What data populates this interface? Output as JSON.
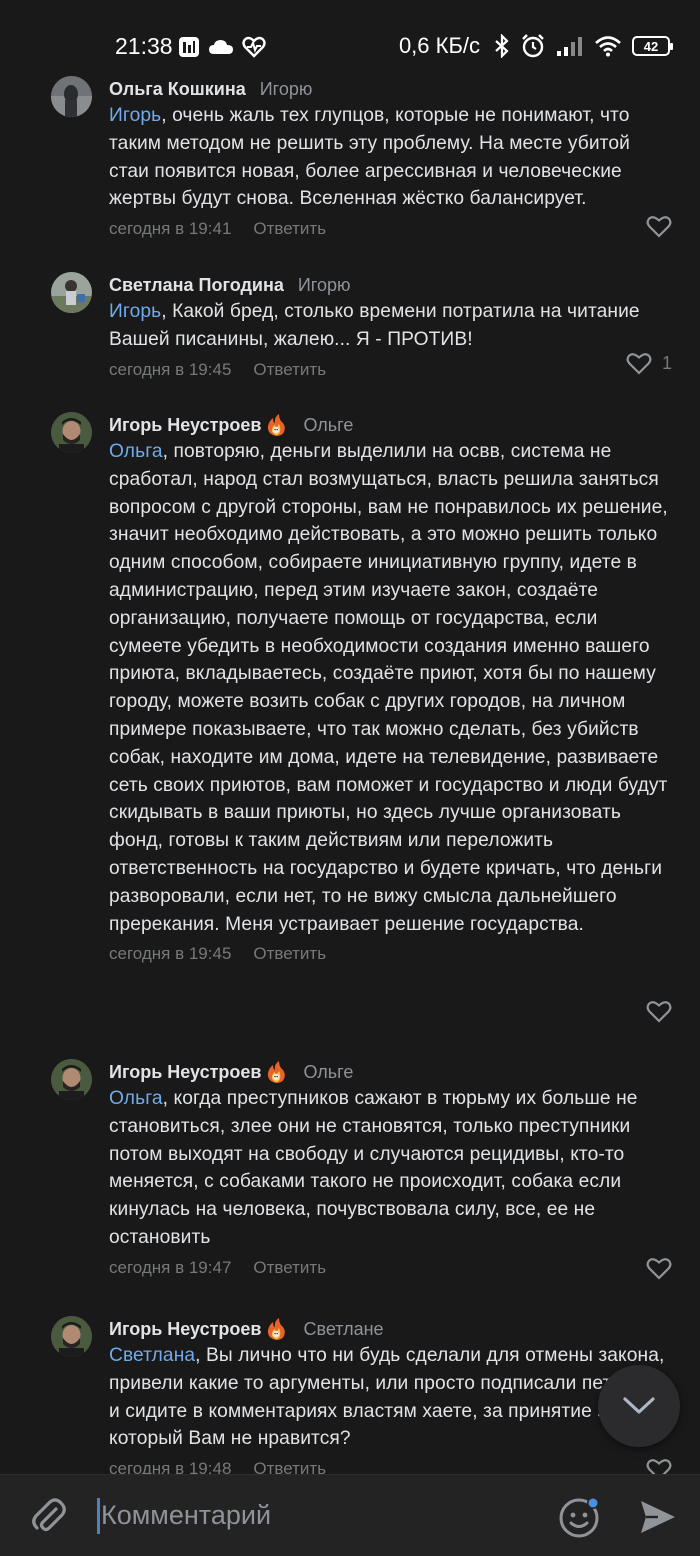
{
  "status_bar": {
    "time": "21:38",
    "speed": "0,6 КБ/с",
    "battery": "42"
  },
  "comments": [
    {
      "author": "Ольга Кошкина",
      "reply_to": "Игорю",
      "mention": "Игорь",
      "text": ", очень жаль тех глупцов, которые не понимают, что таким методом не решить эту проблему. На месте убитой стаи появится новая, более агрессивная и человеческие жертвы будут снова. Вселенная жёстко балансирует.",
      "time": "сегодня в 19:41",
      "reply_label": "Ответить",
      "likes": ""
    },
    {
      "author": "Светлана Погодина",
      "reply_to": "Игорю",
      "mention": "Игорь",
      "text": ", Какой бред, столько времени потратила на читание Вашей писанины, жалею... Я - ПРОТИВ!",
      "time": "сегодня в 19:45",
      "reply_label": "Ответить",
      "likes": "1"
    },
    {
      "author": "Игорь Неустроев",
      "reply_to": "Ольге",
      "mention": "Ольга",
      "text": ", повторяю, деньги выделили на освв, система не сработал, народ стал возмущаться, власть решила заняться вопросом с другой стороны, вам не понравилось их решение, значит необходимо действовать, а это можно решить только одним способом, собираете инициативную группу, идете в администрацию, перед этим изучаете закон, создаёте организацию, получаете помощь от государства, если сумеете убедить в необходимости создания именно вашего приюта, вкладываетесь, создаёте приют, хотя бы по нашему городу, можете возить собак с других городов, на личном примере показываете, что так можно сделать, без убийств собак, находите им дома, идете на телевидение, развиваете сеть своих приютов, вам поможет и государство и люди будут скидывать в ваши приюты, но здесь лучше организовать фонд, готовы к таким действиям или переложить ответственность на государство и будете кричать, что деньги разворовали, если нет, то не вижу смысла дальнейшего пререкания. Меня устраивает решение государства.",
      "time": "сегодня в 19:45",
      "reply_label": "Ответить",
      "likes": ""
    },
    {
      "author": "Игорь Неустроев",
      "reply_to": "Ольге",
      "mention": "Ольга",
      "text": ", когда преступников сажают в тюрьму их больше не становиться, злее они не становятся, только преступники потом выходят на свободу и случаются рецидивы, кто-то меняется, с собаками такого не происходит, собака если кинулась на человека, почувствовала силу, все, ее не остановить",
      "time": "сегодня в 19:47",
      "reply_label": "Ответить",
      "likes": ""
    },
    {
      "author": "Игорь Неустроев",
      "reply_to": "Светлане",
      "mention": "Светлана",
      "text": ", Вы лично что ни будь сделали для отмены закона, привели какие то аргументы, или просто подписали петицию и сидите в комментариях властям хаете, за принятие закона, который Вам не нравится?",
      "time": "сегодня в 19:48",
      "reply_label": "Ответить",
      "likes": ""
    }
  ],
  "composer": {
    "placeholder": "Комментарий"
  }
}
